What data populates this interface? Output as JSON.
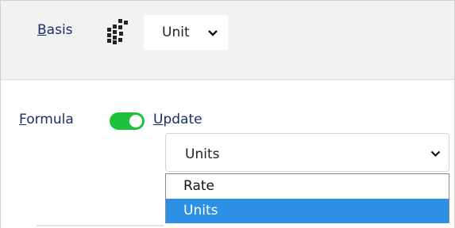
{
  "header": {
    "basis_accel": "B",
    "basis_rest": "asis",
    "icon": "grid-pattern-icon",
    "unit_select": {
      "value": "Unit",
      "icon": "chevron-down-icon"
    }
  },
  "formula": {
    "label_accel": "F",
    "label_rest": "ormula",
    "toggle": {
      "state": "on",
      "color": "#1ec23a"
    },
    "update_accel": "U",
    "update_rest": "pdate",
    "select": {
      "value": "Units",
      "icon": "chevron-down-icon",
      "options": [
        "Rate",
        "Units"
      ],
      "highlighted": "Units",
      "highlight_color": "#2e8fe6"
    }
  }
}
